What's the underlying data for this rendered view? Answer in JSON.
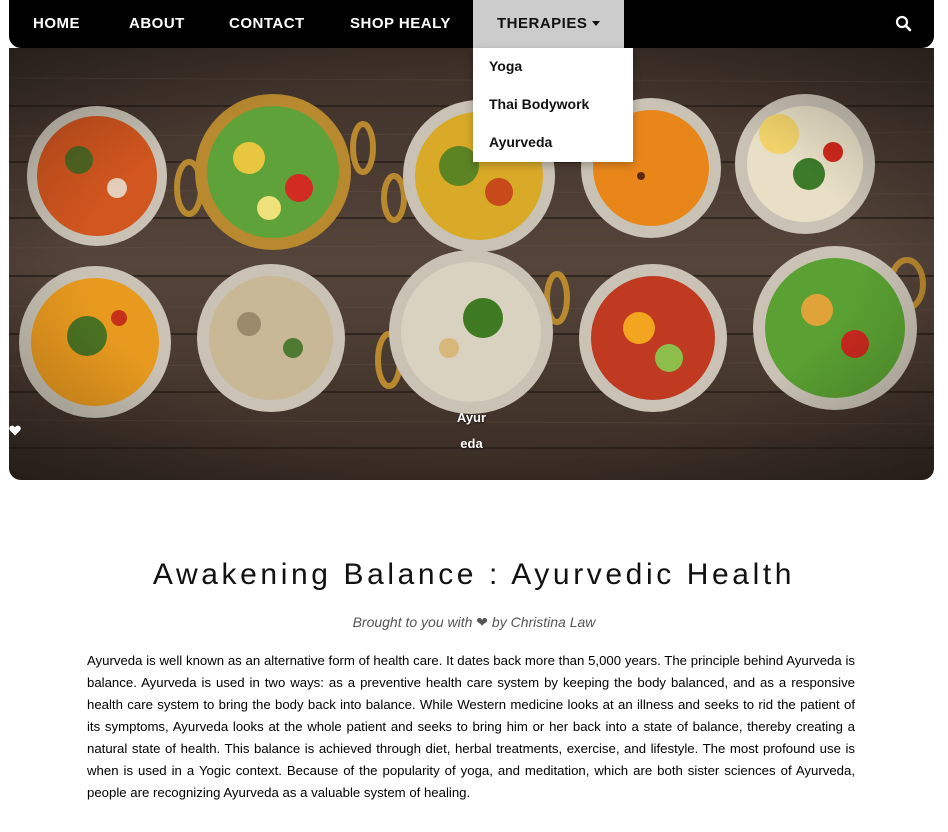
{
  "nav": {
    "items": [
      "HOME",
      "ABOUT",
      "CONTACT",
      "SHOP HEALY"
    ],
    "active_label": "THERAPIES",
    "search_icon": "search-icon"
  },
  "dropdown": {
    "items": [
      "Yoga",
      "Thai Bodywork",
      "Ayurveda"
    ]
  },
  "hero": {
    "caption_left": "Ayur",
    "caption_right": "eda",
    "caption_icon": "heart-icon"
  },
  "article": {
    "title": "Awakening Balance : Ayurvedic Health",
    "byline": "Brought to you with ❤ by Christina Law",
    "body": "Ayurveda is well known as an alternative form of health care. It dates back more than 5,000 years. The principle behind Ayurveda is balance. Ayurveda is used in two ways: as a preventive health care system by keeping the body balanced, and as a responsive health care system to bring the body back into balance. While Western medicine looks at an illness and seeks to rid the patient of its symptoms, Ayurveda looks at the whole patient and seeks to bring him or her back into a state of balance, thereby creating a natural state of health. This balance is achieved through diet, herbal treatments, exercise, and lifestyle. The most profound use is when is used in a Yogic context. Because of the popularity of yoga, and meditation, which are both sister sciences of Ayurveda, people are recognizing Ayurveda as a valuable system of healing."
  },
  "colors": {
    "nav_bg": "#000000",
    "active_tab_bg": "#cccccc",
    "wood": "#4a3a2c",
    "brass": "#b8892f"
  }
}
